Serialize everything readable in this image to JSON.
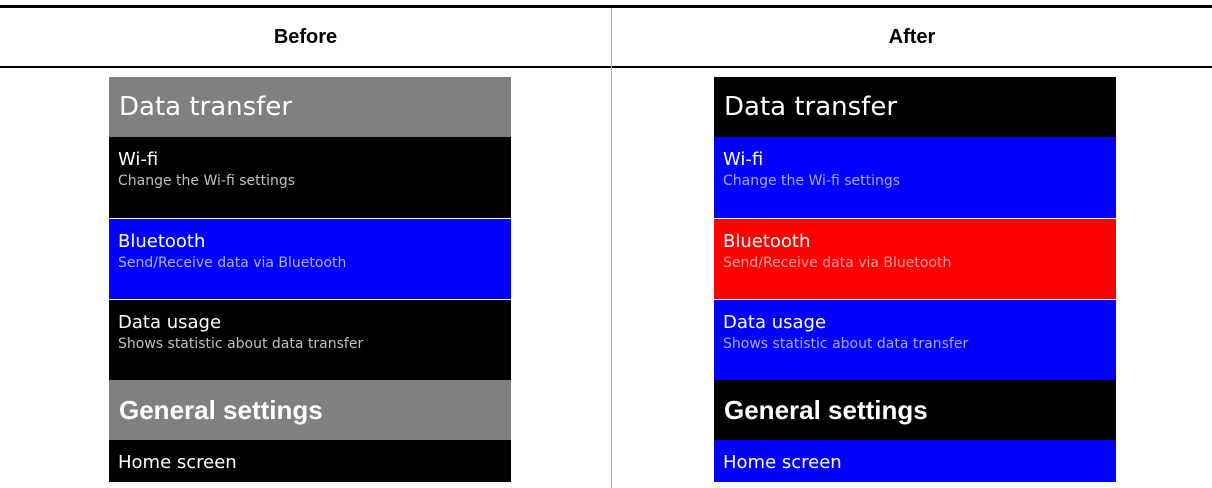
{
  "headers": {
    "before": "Before",
    "after": "After"
  },
  "colors": {
    "before_section_bg": "#808080",
    "before_item_bg": "#000000",
    "before_selected_bg": "#0000ff",
    "before_subtitle": "#c0c0c0",
    "after_section_bg": "#000000",
    "after_item_bg": "#0000ff",
    "after_selected_bg": "#ff0000",
    "after_subtitle": "#a8a8ff",
    "after_selected_subtitle": "#ffa0a0"
  },
  "before": {
    "section1": "Data transfer",
    "items": [
      {
        "title": "Wi-fi",
        "subtitle": "Change the Wi-fi settings",
        "selected": false
      },
      {
        "title": "Bluetooth",
        "subtitle": "Send/Receive data via Bluetooth",
        "selected": true
      },
      {
        "title": "Data usage",
        "subtitle": "Shows statistic about data transfer",
        "selected": false
      }
    ],
    "section2": "General settings",
    "last_item": {
      "title": "Home screen"
    }
  },
  "after": {
    "section1": "Data transfer",
    "items": [
      {
        "title": "Wi-fi",
        "subtitle": "Change the Wi-fi settings",
        "selected": false
      },
      {
        "title": "Bluetooth",
        "subtitle": "Send/Receive data via Bluetooth",
        "selected": true
      },
      {
        "title": "Data usage",
        "subtitle": "Shows statistic about data transfer",
        "selected": false
      }
    ],
    "section2": "General settings",
    "last_item": {
      "title": "Home screen"
    }
  }
}
